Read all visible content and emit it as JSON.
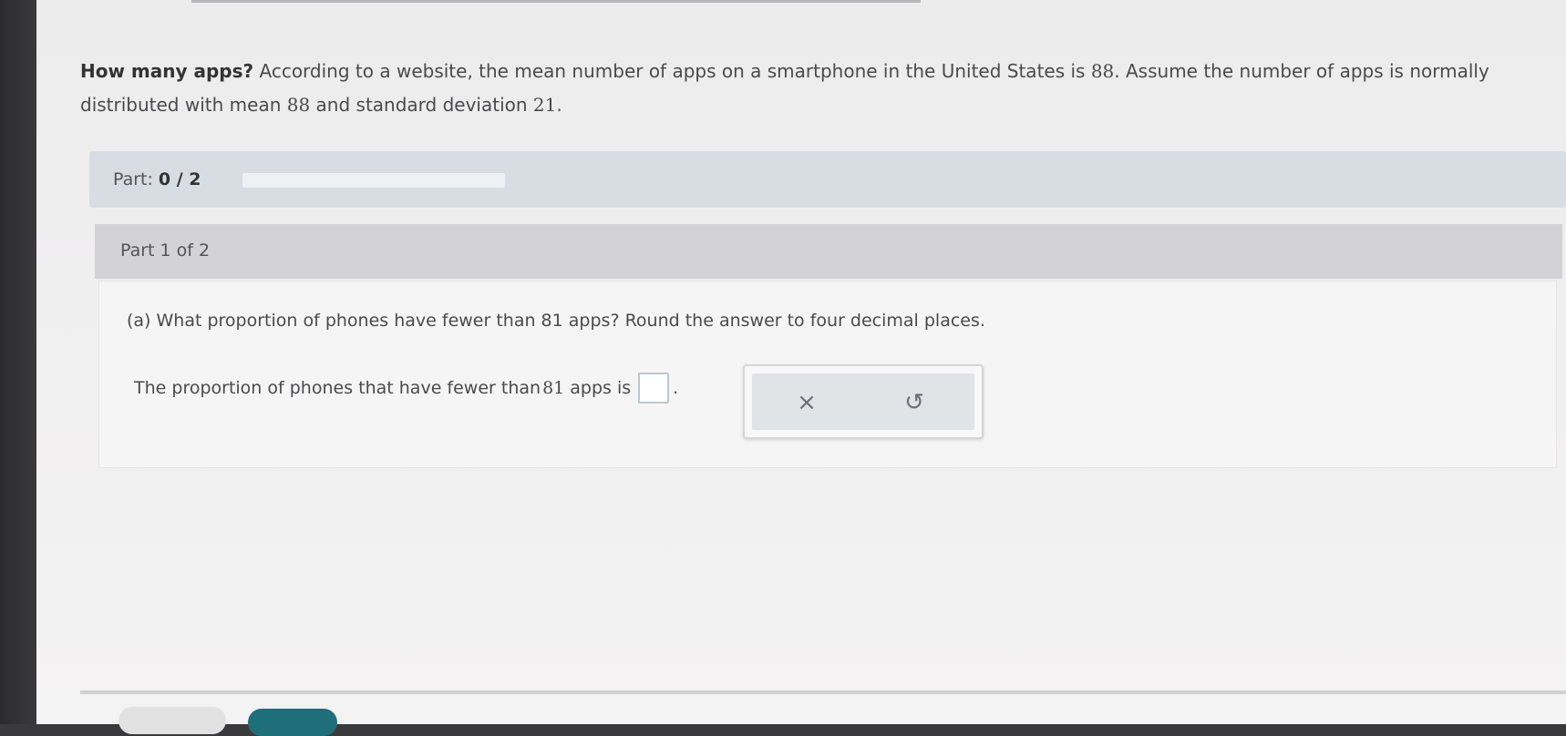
{
  "problem": {
    "bold_lead": "How many apps?",
    "text_1": " According to a website, the mean number of apps on a smartphone in the United States is ",
    "mean_value": "88",
    "text_2": ". Assume the number of apps is normally distributed with mean ",
    "mean_value_2": "88",
    "text_3": " and standard deviation ",
    "sd_value": "21",
    "text_4": "."
  },
  "part_bar": {
    "label": "Part:",
    "progress_text": "0 / 2",
    "progress_fraction": 0
  },
  "part_header": "Part 1 of 2",
  "question": {
    "text": "(a) What proportion of phones have fewer than 81 apps? Round the answer to four decimal places."
  },
  "answer": {
    "prefix": "The proportion of phones that have fewer than ",
    "number": "81",
    "suffix": " apps is",
    "period": "."
  },
  "tools": {
    "clear_glyph": "×",
    "undo_glyph": "↺"
  },
  "colors": {
    "progress_fill": "#8fb04d",
    "primary_button": "#1f6f7a"
  }
}
